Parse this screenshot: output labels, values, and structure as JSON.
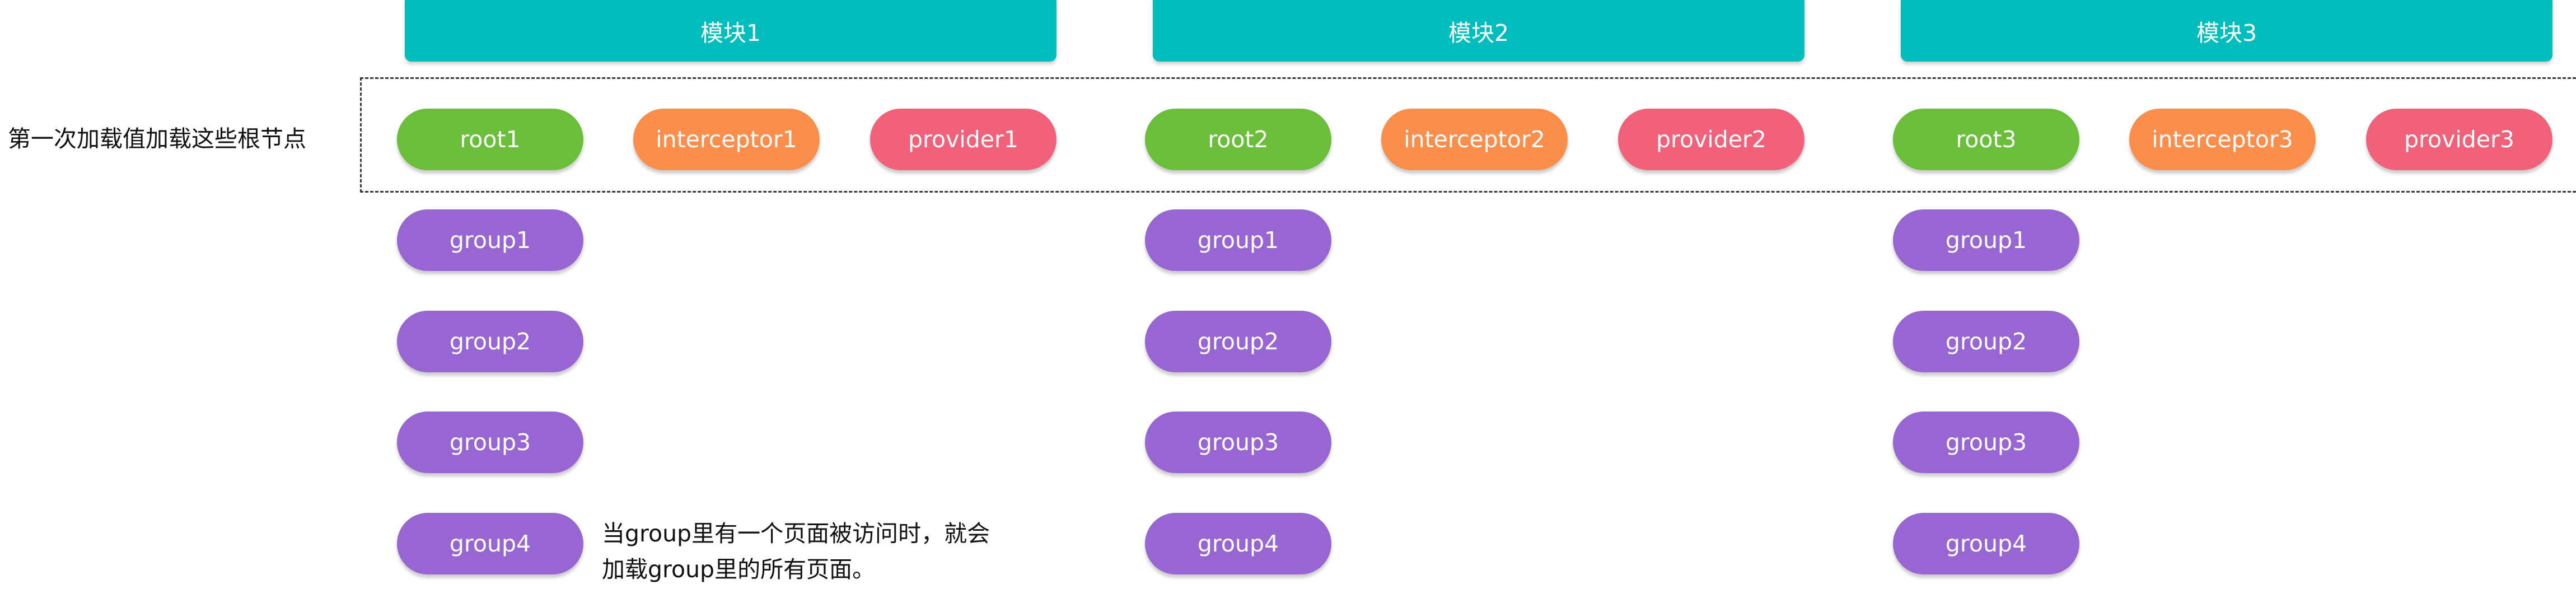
{
  "modules": [
    {
      "title": "模块1",
      "root": "root1",
      "interceptor": "interceptor1",
      "provider": "provider1",
      "groups": [
        "group1",
        "group2",
        "group3",
        "group4"
      ]
    },
    {
      "title": "模块2",
      "root": "root2",
      "interceptor": "interceptor2",
      "provider": "provider2",
      "groups": [
        "group1",
        "group2",
        "group3",
        "group4"
      ]
    },
    {
      "title": "模块3",
      "root": "root3",
      "interceptor": "interceptor3",
      "provider": "provider3",
      "groups": [
        "group1",
        "group2",
        "group3",
        "group4"
      ]
    }
  ],
  "first_load_label": "第一次加载值加载这些根节点",
  "note": {
    "line1": "当group里有一个页面被访问时，就会",
    "line2": "加载group里的所有页面。"
  },
  "colors": {
    "module_header": "#00bdbd",
    "root": "#6abe39",
    "interceptor": "#fc8e4b",
    "provider": "#f1627a",
    "group": "#9766d3"
  }
}
